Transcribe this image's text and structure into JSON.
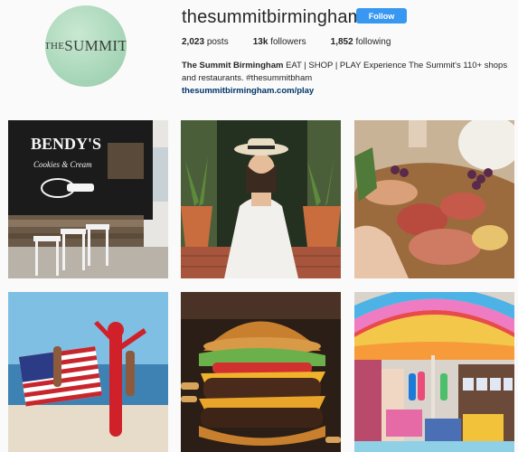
{
  "profile": {
    "username": "thesummitbirmingham",
    "follow_label": "Follow",
    "logo_text_prefix": "THE",
    "logo_text_main": "SUMMIT",
    "stats": {
      "posts": "2,023",
      "posts_label": "posts",
      "followers": "13k",
      "followers_label": "followers",
      "following": "1,852",
      "following_label": "following"
    },
    "bio": {
      "name": "The Summit Birmingham",
      "text": "EAT | SHOP | PLAY Experience The Summit's 110+ shops and restaurants. #thesummitbham",
      "link": "thesummitbirmingham.com/play"
    }
  },
  "posts": [
    {
      "subject": "food-truck",
      "sign_text": "BENDY'S",
      "sign_sub": "Cookies & Cream"
    },
    {
      "subject": "woman-in-hat"
    },
    {
      "subject": "charcuterie-board"
    },
    {
      "subject": "beach-flag-inflatable"
    },
    {
      "subject": "cheeseburger"
    },
    {
      "subject": "rainbow-umbrella-shop"
    }
  ],
  "colors": {
    "follow_blue": "#3897f0",
    "link_blue": "#003569",
    "avatar_green": "#a9d7b9"
  }
}
